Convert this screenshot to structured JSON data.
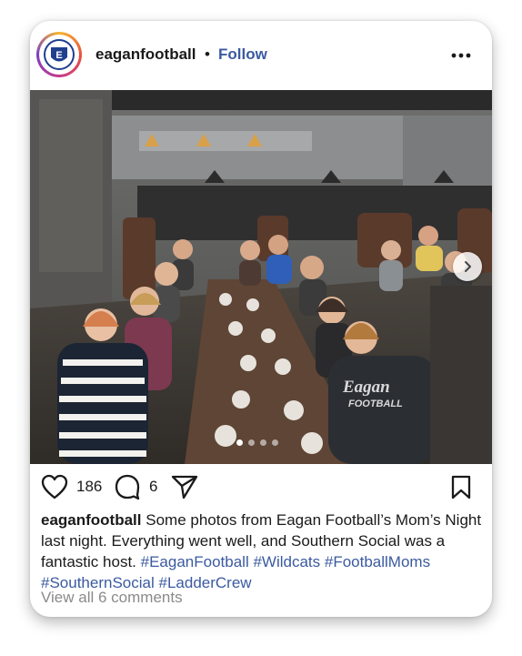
{
  "post": {
    "username": "eaganfootball",
    "separator": "•",
    "follow_label": "Follow",
    "avatar_text": "E",
    "carousel": {
      "current_index": 1,
      "total": 4
    },
    "likes": "186",
    "comments_count": "6",
    "caption": {
      "username": "eaganfootball",
      "text": "Some photos from Eagan Football’s Mom’s Night last night.  Everything went well, and Southern Social was a fantastic host.",
      "hashtags": [
        "#EaganFootball",
        "#Wildcats",
        "#FootballMoms",
        "#SouthernSocial",
        "#LadderCrew"
      ]
    },
    "view_comments": "View all 6 comments",
    "sweatshirt_text": [
      "Eagan",
      "FOOTBALL"
    ]
  },
  "icons": {
    "more": "more-options-icon",
    "like": "heart-icon",
    "comment": "comment-icon",
    "share": "share-icon",
    "save": "bookmark-icon",
    "next": "chevron-right-icon"
  },
  "colors": {
    "link": "#3b5aa0",
    "muted": "#8a8a8a",
    "text": "#1a1a1a"
  }
}
